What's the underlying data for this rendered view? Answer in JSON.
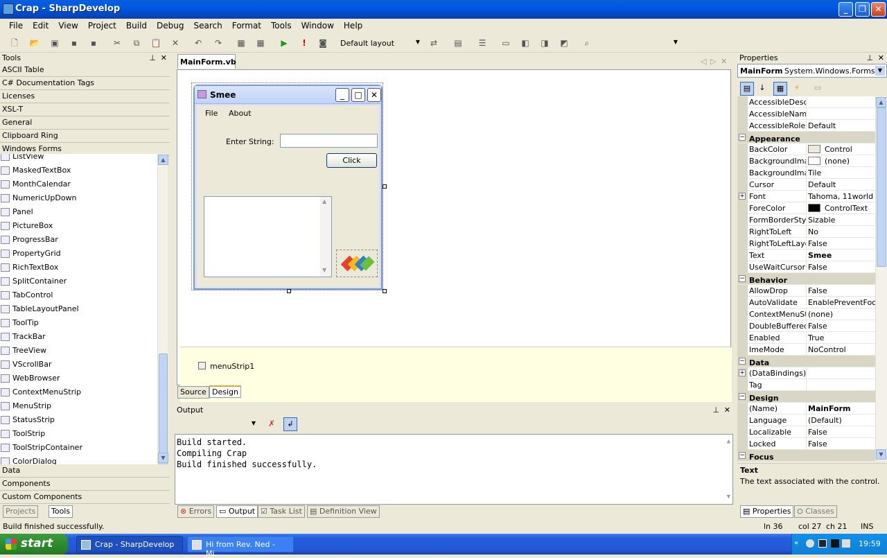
{
  "window": {
    "title": "Crap - SharpDevelop"
  },
  "menu": [
    "File",
    "Edit",
    "View",
    "Project",
    "Build",
    "Debug",
    "Search",
    "Format",
    "Tools",
    "Window",
    "Help"
  ],
  "toolbar": {
    "layout_combo": "Default layout",
    "search_combo": ""
  },
  "tools_pane": {
    "title": "Tools",
    "categories_top": [
      "ASCII Table",
      "C# Documentation Tags",
      "Licenses",
      "XSL-T",
      "General",
      "Clipboard Ring",
      "Windows Forms"
    ],
    "items": [
      "ListView",
      "MaskedTextBox",
      "MonthCalendar",
      "NumericUpDown",
      "Panel",
      "PictureBox",
      "ProgressBar",
      "PropertyGrid",
      "RichTextBox",
      "SplitContainer",
      "TabControl",
      "TableLayoutPanel",
      "ToolTip",
      "TrackBar",
      "TreeView",
      "VScrollBar",
      "WebBrowser",
      "ContextMenuStrip",
      "MenuStrip",
      "StatusStrip",
      "ToolStrip",
      "ToolStripContainer",
      "ColorDialog"
    ],
    "categories_bottom": [
      "Data",
      "Components",
      "Custom Components"
    ],
    "bottom_tabs": [
      "Projects",
      "Tools"
    ]
  },
  "document": {
    "tab": "MainForm.vb",
    "form": {
      "title": "Smee",
      "menu": [
        "File",
        "About"
      ],
      "label": "Enter String:",
      "input_value": "",
      "button": "Click"
    },
    "tray_component": "menuStrip1",
    "view_tabs": [
      "Source",
      "Design"
    ]
  },
  "output": {
    "title": "Output",
    "combo": "",
    "lines": [
      "Build started.",
      "Compiling Crap",
      "Build finished successfully."
    ],
    "bottom_tabs": [
      "Errors",
      "Output",
      "Task List",
      "Definition View"
    ]
  },
  "properties": {
    "title": "Properties",
    "object": "MainForm",
    "object_type": "System.Windows.Forms.Fo",
    "rows": [
      {
        "name": "AccessibleDescri",
        "value": ""
      },
      {
        "name": "AccessibleName",
        "value": ""
      },
      {
        "name": "AccessibleRole",
        "value": "Default"
      },
      {
        "cat": "Appearance"
      },
      {
        "name": "BackColor",
        "value": "Control",
        "swatch": "#ece9d8"
      },
      {
        "name": "BackgroundImag",
        "value": "(none)",
        "swatch": "#ffffff"
      },
      {
        "name": "BackgroundImag",
        "value": "Tile"
      },
      {
        "name": "Cursor",
        "value": "Default"
      },
      {
        "name": "Font",
        "value": "Tahoma, 11world",
        "expand": true
      },
      {
        "name": "ForeColor",
        "value": "ControlText",
        "swatch": "#000000"
      },
      {
        "name": "FormBorderStyle",
        "value": "Sizable"
      },
      {
        "name": "RightToLeft",
        "value": "No"
      },
      {
        "name": "RightToLeftLayou",
        "value": "False"
      },
      {
        "name": "Text",
        "value": "Smee",
        "bold": true
      },
      {
        "name": "UseWaitCursor",
        "value": "False"
      },
      {
        "cat": "Behavior"
      },
      {
        "name": "AllowDrop",
        "value": "False"
      },
      {
        "name": "AutoValidate",
        "value": "EnablePreventFocus"
      },
      {
        "name": "ContextMenuStri",
        "value": "(none)"
      },
      {
        "name": "DoubleBuffered",
        "value": "False"
      },
      {
        "name": "Enabled",
        "value": "True"
      },
      {
        "name": "ImeMode",
        "value": "NoControl"
      },
      {
        "cat": "Data"
      },
      {
        "name": "(DataBindings)",
        "value": "",
        "expand": true
      },
      {
        "name": "Tag",
        "value": ""
      },
      {
        "cat": "Design"
      },
      {
        "name": "(Name)",
        "value": "MainForm",
        "bold": true
      },
      {
        "name": "Language",
        "value": "(Default)"
      },
      {
        "name": "Localizable",
        "value": "False"
      },
      {
        "name": "Locked",
        "value": "False"
      },
      {
        "cat": "Focus"
      }
    ],
    "help_title": "Text",
    "help_text": "The text associated with the control.",
    "bottom_tabs": [
      "Properties",
      "Classes"
    ]
  },
  "status": {
    "message": "Build finished successfully.",
    "line": "ln 36",
    "col": "col 27",
    "ch": "ch 21",
    "mode": "INS"
  },
  "taskbar": {
    "start": "start",
    "tasks": [
      "Crap - SharpDevelop",
      "Hi from Rev. Ned - Mi..."
    ],
    "clock": "19:59"
  }
}
